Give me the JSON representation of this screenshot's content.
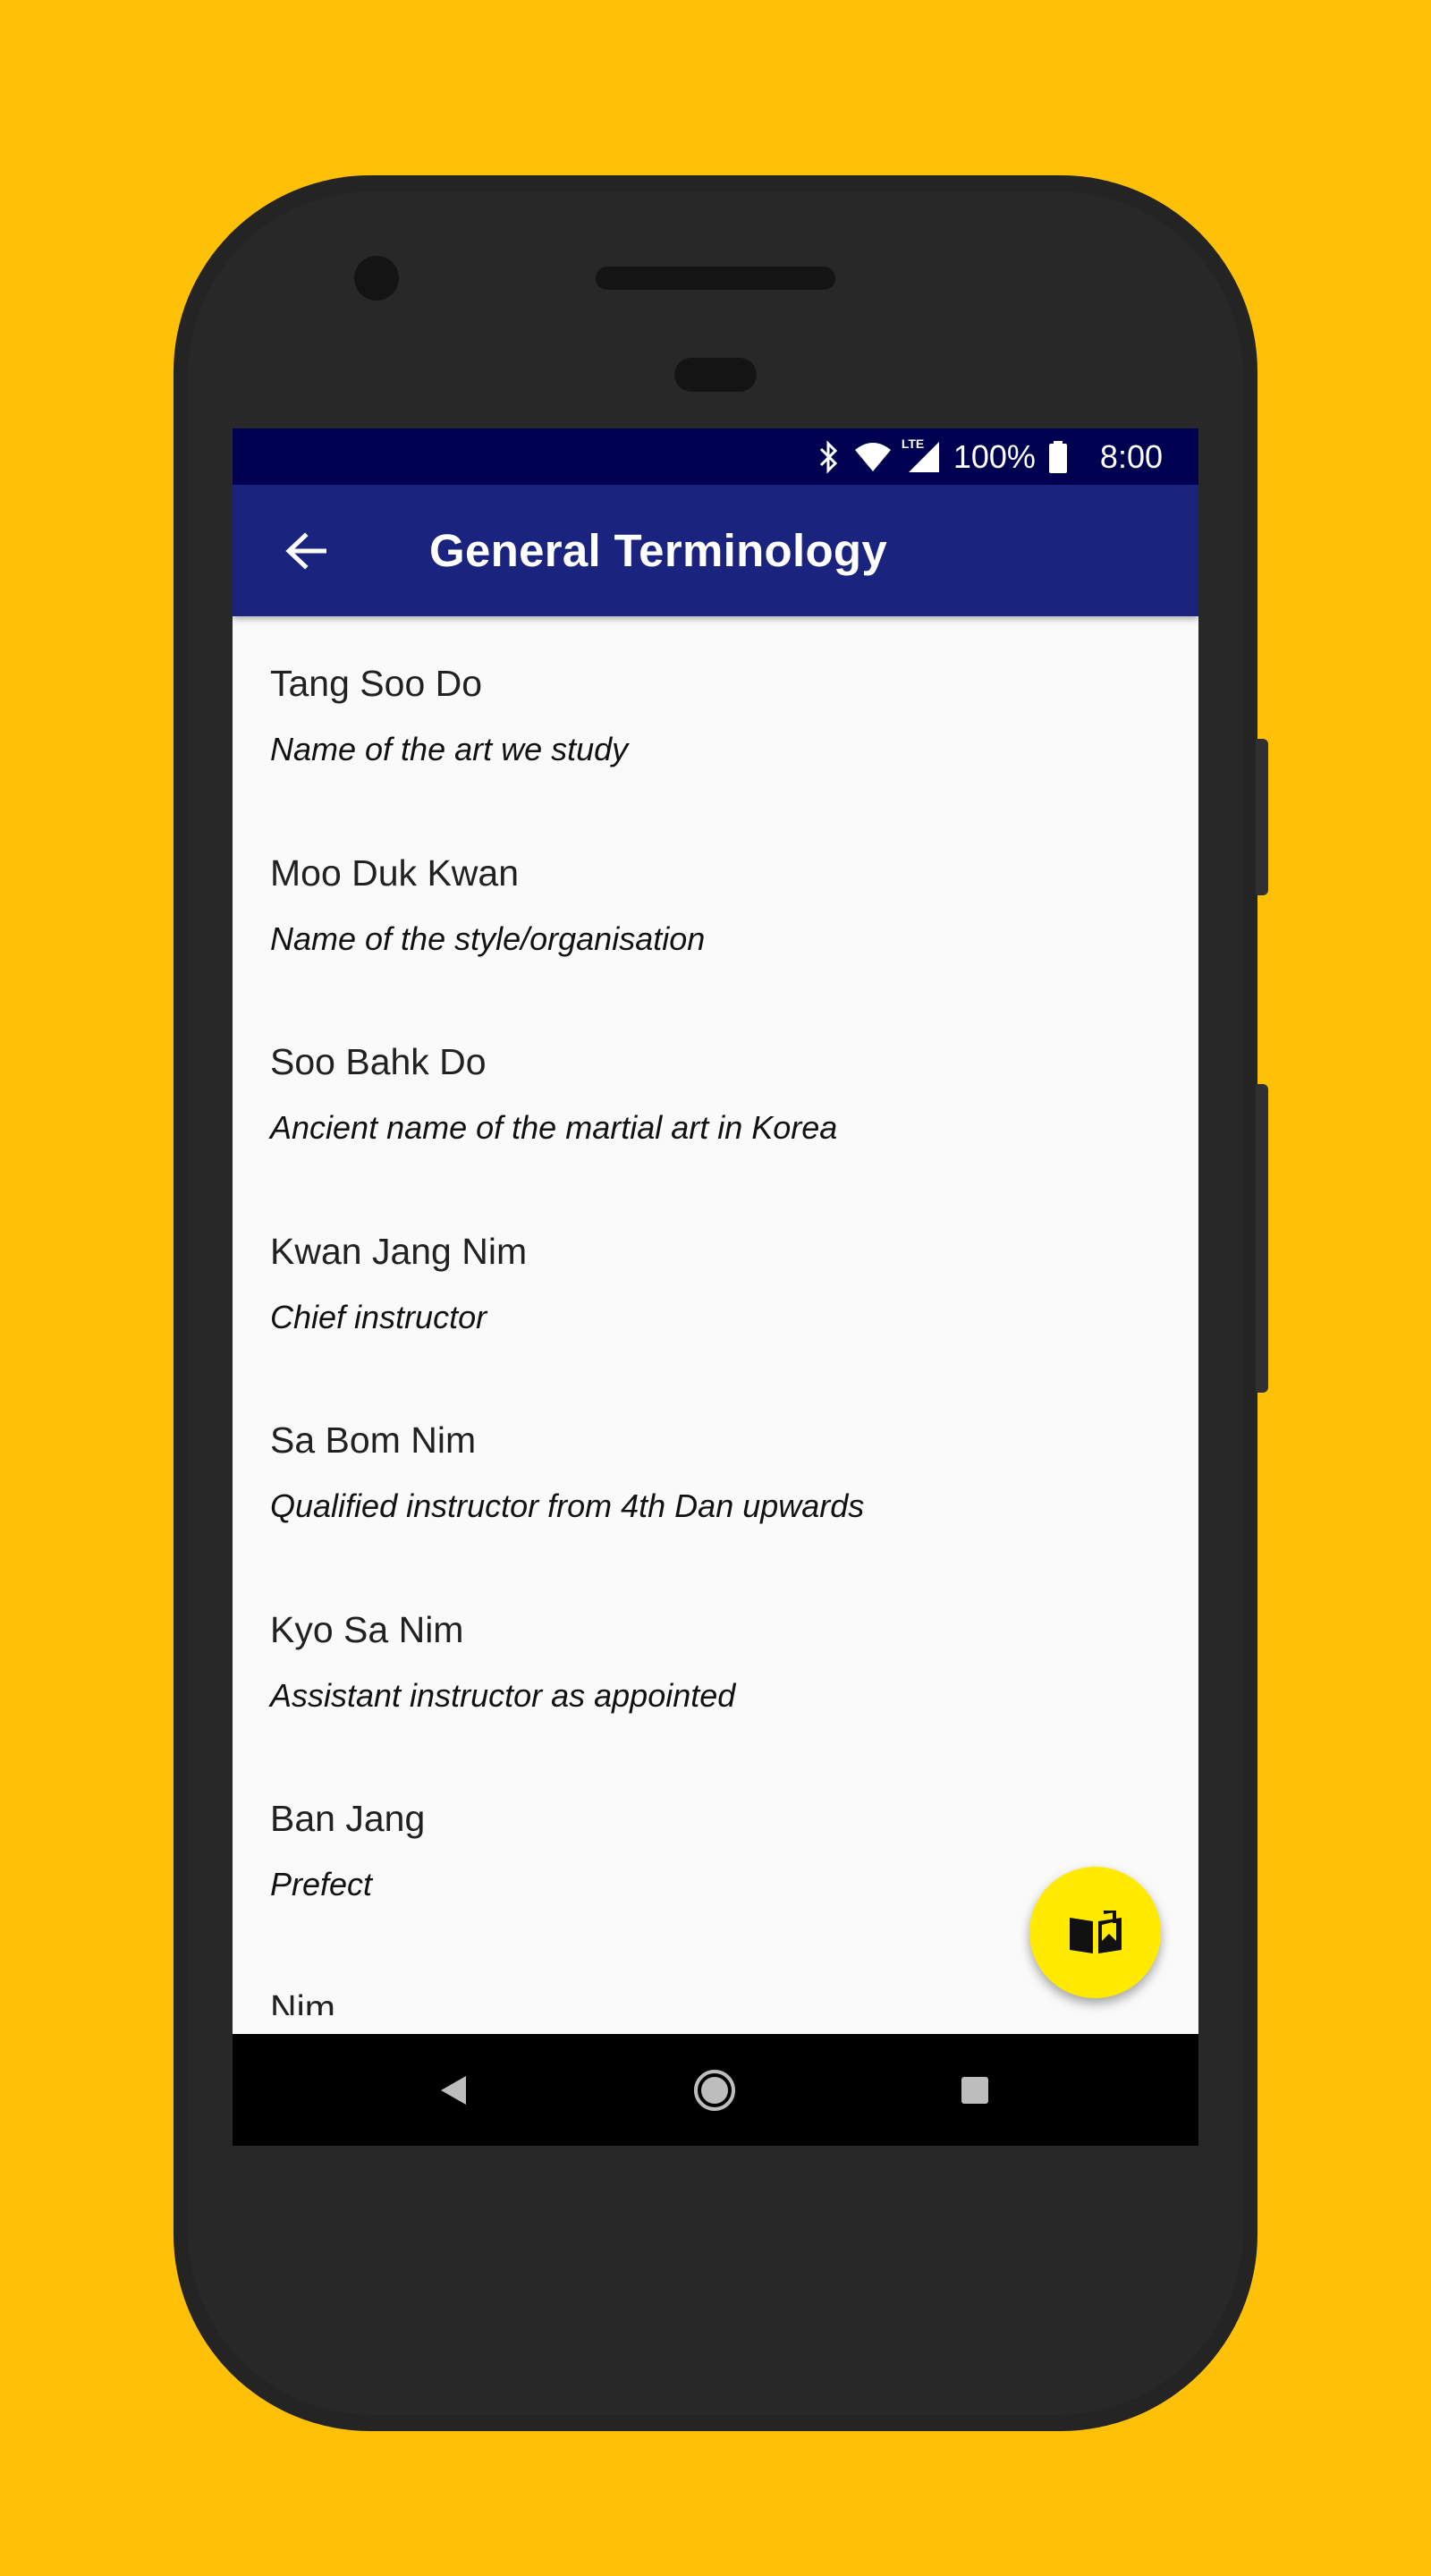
{
  "status_bar": {
    "battery_percent": "100%",
    "time": "8:00",
    "network_label": "LTE",
    "icons": [
      "bluetooth-icon",
      "wifi-icon",
      "lte-signal-icon",
      "battery-icon"
    ]
  },
  "app_bar": {
    "title": "General Terminology",
    "back_icon": "arrow-back-icon"
  },
  "terms": [
    {
      "term": "Tang Soo Do",
      "meaning": "Name of the art we study"
    },
    {
      "term": "Moo Duk Kwan",
      "meaning": "Name of the style/organisation"
    },
    {
      "term": "Soo Bahk Do",
      "meaning": "Ancient name of the martial art in Korea"
    },
    {
      "term": "Kwan Jang Nim",
      "meaning": "Chief instructor"
    },
    {
      "term": "Sa Bom Nim",
      "meaning": "Qualified instructor from 4th Dan upwards"
    },
    {
      "term": "Kyo Sa Nim",
      "meaning": "Assistant instructor as appointed"
    },
    {
      "term": "Ban Jang",
      "meaning": "Prefect"
    },
    {
      "term": "Nim",
      "meaning": ""
    }
  ],
  "fab": {
    "icon": "book-open-icon"
  },
  "nav_bar": {
    "icons": [
      "nav-back-icon",
      "nav-home-icon",
      "nav-recents-icon"
    ]
  },
  "colors": {
    "background": "#FFC107",
    "status_bar": "#000050",
    "app_bar": "#1A237E",
    "fab": "#FFEA00",
    "list_bg": "#FAFAFA"
  }
}
